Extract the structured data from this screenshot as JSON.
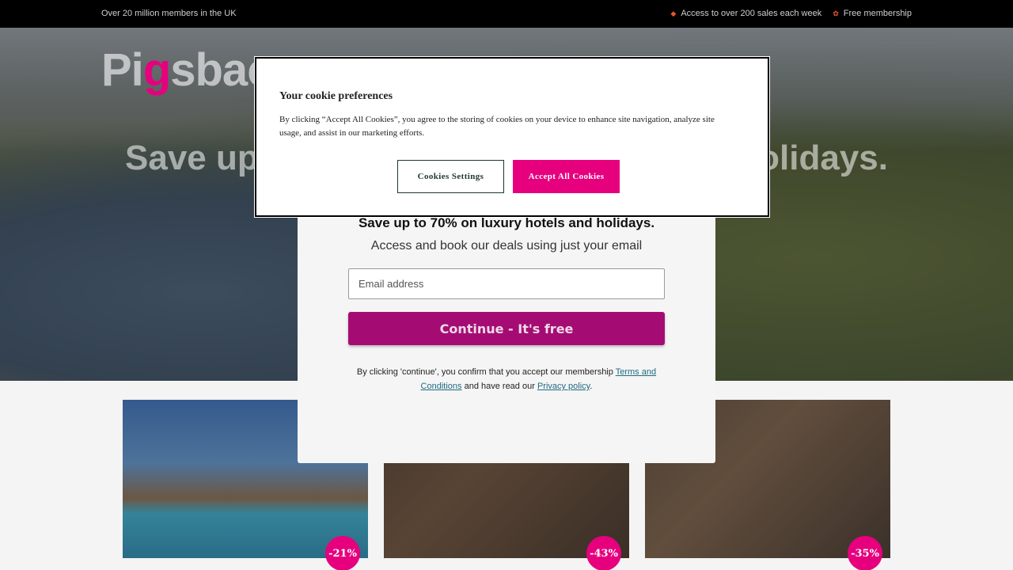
{
  "topbar": {
    "members": "Over 20 million members in the UK",
    "sales": "Access to over 200 sales each week",
    "membership": "Free membership",
    "sales_icon": "tag-icon",
    "membership_icon": "gift-icon"
  },
  "hero": {
    "logo_pre": "Pi",
    "logo_g": "g",
    "logo_post": "sbac",
    "title_left": "Save up",
    "title_right": "olidays."
  },
  "cards": [
    {
      "discount": "-21%"
    },
    {
      "discount": "-43%"
    },
    {
      "discount": "-35%"
    }
  ],
  "signup": {
    "title": "Save up to 70% on luxury hotels and holidays.",
    "subtitle": "Access and book our deals using just your email",
    "email_placeholder": "Email address",
    "continue_label": "Continue - It's free",
    "legal_1": "By clicking 'continue', you confirm that you accept our membership ",
    "terms_link": "Terms and Conditions",
    "legal_2": " and have read our ",
    "privacy_link": "Privacy policy",
    "legal_3": "."
  },
  "cookie": {
    "title": "Your cookie preferences",
    "text": "By clicking “Accept All Cookies”, you agree to the storing of cookies on your device to enhance site navigation, analyze site usage, and assist in our marketing efforts.",
    "settings_label": "Cookies Settings",
    "accept_label": "Accept All Cookies"
  },
  "colors": {
    "brand": "#e6007e",
    "continue": "#a50c73",
    "link": "#1f6a82"
  }
}
